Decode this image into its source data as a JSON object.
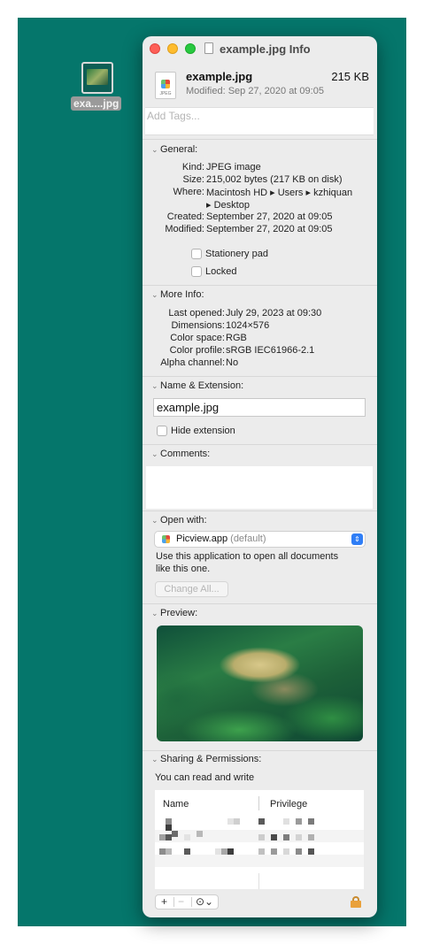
{
  "desktop": {
    "icon_label": "exa....jpg",
    "background_color": "#05766b"
  },
  "window": {
    "title": "example.jpg Info",
    "file_name": "example.jpg",
    "file_size": "215 KB",
    "modified_summary": "Modified: Sep 27, 2020 at 09:05",
    "file_icon_ext": "JPEG",
    "tags_placeholder": "Add Tags..."
  },
  "general": {
    "header": "General:",
    "rows": [
      {
        "label": "Kind:",
        "value": "JPEG image"
      },
      {
        "label": "Size:",
        "value": "215,002 bytes (217 KB on disk)"
      },
      {
        "label": "Where:",
        "value": "Macintosh HD ▸ Users ▸ kzhiquan"
      },
      {
        "label": "",
        "value": "▸ Desktop"
      },
      {
        "label": "Created:",
        "value": "September 27, 2020 at 09:05"
      },
      {
        "label": "Modified:",
        "value": "September 27, 2020 at 09:05"
      }
    ],
    "stationery_label": "Stationery pad",
    "locked_label": "Locked"
  },
  "more_info": {
    "header": "More Info:",
    "rows": [
      {
        "label": "Last opened:",
        "value": "July 29, 2023 at 09:30"
      },
      {
        "label": "Dimensions:",
        "value": "1024×576"
      },
      {
        "label": "Color space:",
        "value": "RGB"
      },
      {
        "label": "Color profile:",
        "value": "sRGB IEC61966-2.1"
      },
      {
        "label": "Alpha channel:",
        "value": "No"
      }
    ]
  },
  "name_extension": {
    "header": "Name & Extension:",
    "name_value": "example.jpg",
    "hide_extension_label": "Hide extension"
  },
  "comments": {
    "header": "Comments:"
  },
  "open_with": {
    "header": "Open with:",
    "app_name": "Picview.app",
    "app_default": "(default)",
    "description_line1": "Use this application to open all documents",
    "description_line2": "like this one.",
    "change_all_label": "Change All..."
  },
  "preview": {
    "header": "Preview:"
  },
  "sharing": {
    "header": "Sharing & Permissions:",
    "summary": "You can read and write",
    "col_name": "Name",
    "col_privilege": "Privilege",
    "add_label": "+",
    "remove_label": "−",
    "action_label": "⊙⌄"
  },
  "colors": {
    "close": "#fe5f57",
    "minimize": "#febc2e",
    "zoom": "#28c840",
    "accent": "#2f7ef6"
  }
}
